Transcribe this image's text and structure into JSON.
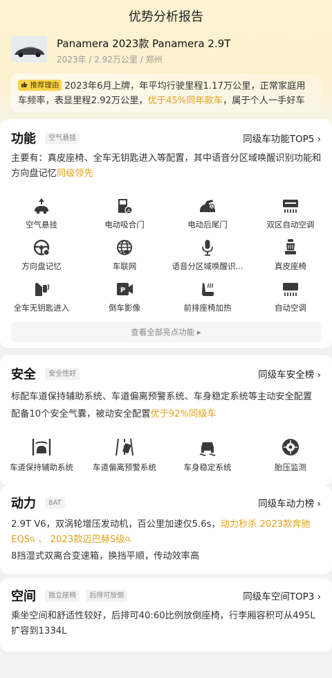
{
  "page": {
    "title": "优势分析报告"
  },
  "car": {
    "name": "Panamera 2023款 Panamera 2.9T",
    "meta": "2023年 / 2.92万公里 / 郑州"
  },
  "reason": {
    "badge": "推荐理由",
    "text_before": "2023年6月上牌，年平均行驶里程1.17万公里，正常家庭用车频率，表显里程2.92万公里，",
    "highlight": "优于45%同年款车",
    "text_after": "，属于个人一手好车"
  },
  "function": {
    "title": "功能",
    "tag": "空气悬挂",
    "link": "同级车功能TOP5 ›",
    "desc_before": "主要有：真皮座椅、全车无钥匙进入等配置，其中语音分区域唤醒识别功能和方向盘记忆",
    "desc_highlight": "同级领先",
    "items": [
      {
        "label": "空气悬挂",
        "icon": "air-suspension-icon"
      },
      {
        "label": "电动吸合门",
        "icon": "soft-close-door-icon"
      },
      {
        "label": "电动后尾门",
        "icon": "power-tailgate-icon"
      },
      {
        "label": "双区自动空调",
        "icon": "dual-zone-ac-icon"
      },
      {
        "label": "方向盘记忆",
        "icon": "steering-memory-icon"
      },
      {
        "label": "车联网",
        "icon": "connected-car-icon"
      },
      {
        "label": "语音分区域唤醒识...",
        "icon": "voice-wake-icon"
      },
      {
        "label": "真皮座椅",
        "icon": "leather-seat-icon"
      },
      {
        "label": "全车无钥匙进入",
        "icon": "keyless-entry-icon"
      },
      {
        "label": "倒车影像",
        "icon": "reverse-camera-icon"
      },
      {
        "label": "前排座椅加热",
        "icon": "seat-heating-icon"
      },
      {
        "label": "自动空调",
        "icon": "auto-ac-icon"
      }
    ],
    "view_all": "查看全部亮点功能 ▸"
  },
  "safety": {
    "title": "安全",
    "tag": "安全性好",
    "link": "同级车安全榜 ›",
    "line1": "标配车道保持辅助系统、车道偏离预警系统、车身稳定系统等主动安全配置",
    "line2_before": "配备10个安全气囊，被动安全配置",
    "line2_highlight": "优于92%同级车",
    "items": [
      {
        "label": "车道保持辅助系统",
        "icon": "lane-keep-icon"
      },
      {
        "label": "车道偏离预警系统",
        "icon": "lane-departure-icon"
      },
      {
        "label": "车身稳定系统",
        "icon": "stability-control-icon"
      },
      {
        "label": "胎压监测",
        "icon": "tire-pressure-icon"
      }
    ]
  },
  "power": {
    "title": "动力",
    "tag": "8AT",
    "link": "同级车动力榜 ›",
    "line1_before": "2.9T V6，双涡轮增压发动机，百公里加速仅5.6s，",
    "line1_highlight": "动力秒杀 2023款奔驰EQS",
    "line1_sep": " 、 ",
    "line1_highlight2": "2023款迈巴赫S级",
    "line2": "8挡湿式双离合变速箱，换挡平顺，传动效率高"
  },
  "space": {
    "title": "空间",
    "tags": [
      "独立座椅",
      "后排可放倒"
    ],
    "link": "同级车空间TOP3 ›",
    "desc": "乘坐空间和舒适性较好，后排可40:60比例放倒座椅，行李厢容积可从495L扩容到1334L"
  },
  "colors": {
    "accent": "#e0a21a",
    "badge": "#fbd44a",
    "icon": "#3a3a3a"
  }
}
